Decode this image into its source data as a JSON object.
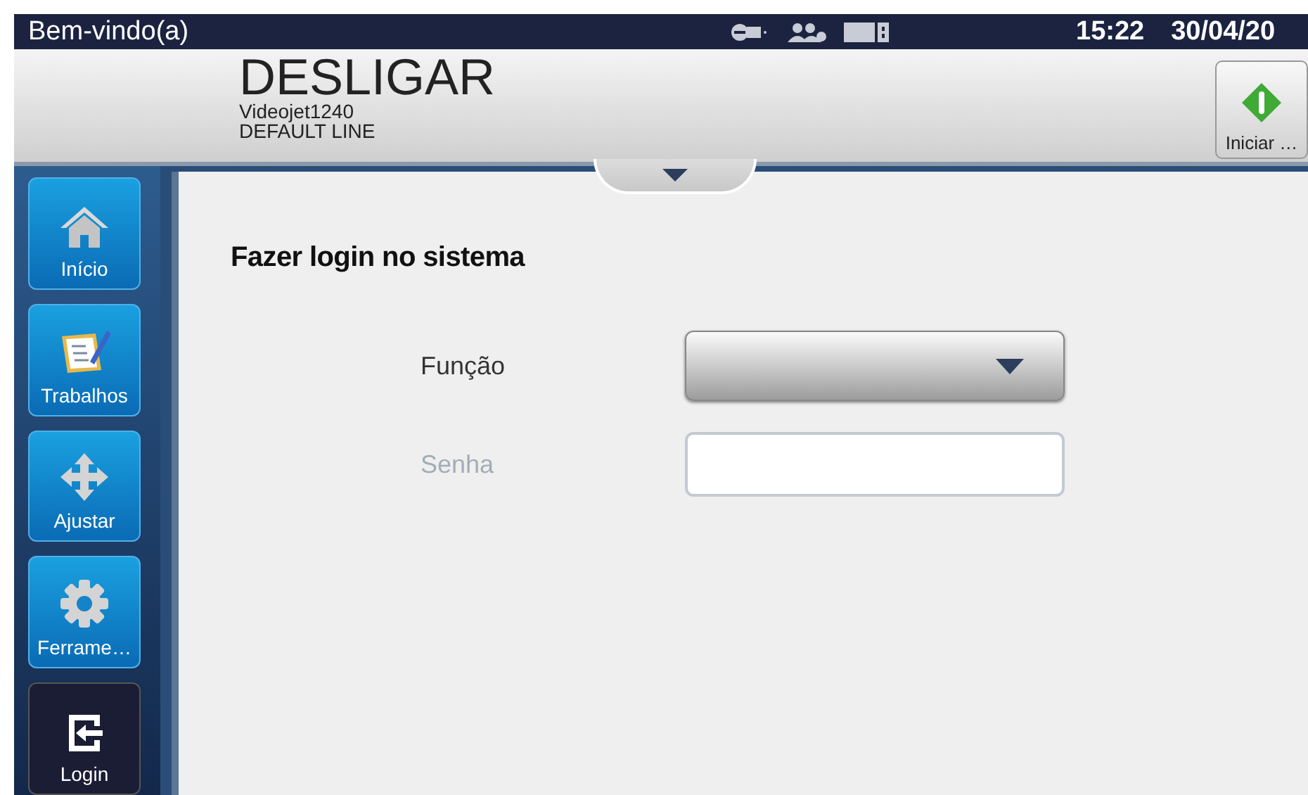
{
  "status_bar": {
    "greeting": "Bem-vindo(a)",
    "time": "15:22",
    "date": "30/04/20"
  },
  "header": {
    "state": "DESLIGAR",
    "printer": "Videojet1240",
    "line": "DEFAULT LINE",
    "start_button": "Iniciar …"
  },
  "sidebar": {
    "items": [
      {
        "label": "Início",
        "kind": "home",
        "selected": false
      },
      {
        "label": "Trabalhos",
        "kind": "jobs",
        "selected": false
      },
      {
        "label": "Ajustar",
        "kind": "adjust",
        "selected": false
      },
      {
        "label": "Ferrame…",
        "kind": "tools",
        "selected": false
      },
      {
        "label": "Login",
        "kind": "login",
        "selected": true
      }
    ]
  },
  "login": {
    "title": "Fazer login no sistema",
    "fields": [
      {
        "label": "Função",
        "kind": "dropdown",
        "disabled": false
      },
      {
        "label": "Senha",
        "kind": "text",
        "disabled": true
      }
    ]
  }
}
